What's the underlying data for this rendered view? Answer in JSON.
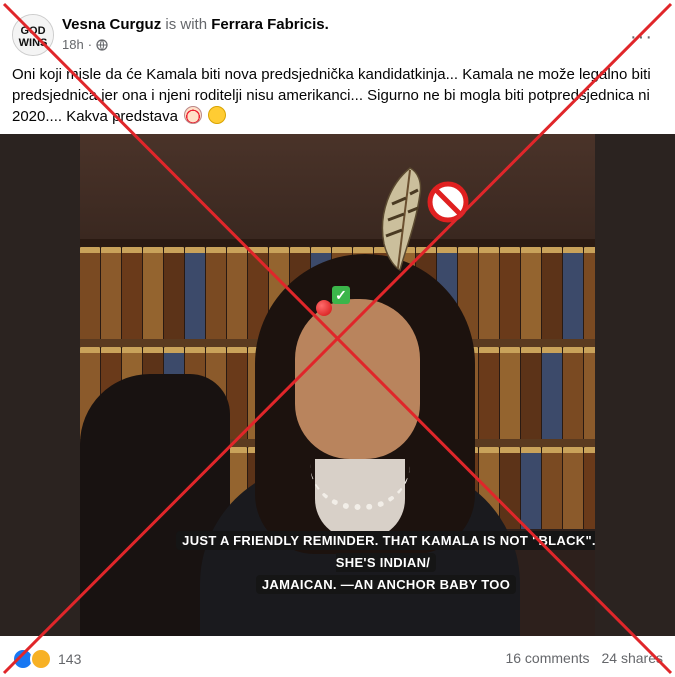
{
  "post": {
    "author": "Vesna Curguz",
    "with_label": "is with",
    "tagged": "Ferrara Fabricis.",
    "time": "18h",
    "separator": "·",
    "more_label": "···",
    "avatar_text": "GOD WINS",
    "body": "Oni koji misle da će Kamala biti nova predsjednička kandidatkinja... Kamala ne može legalno biti predsjednica jer ona i njeni roditelji nisu amerikanci... Sigurno ne bi mogla biti potpredsjednica ni 2020.... Kakva predstava"
  },
  "media": {
    "caption_line1": "JUST A FRIENDLY REMINDER. THAT KAMALA IS NOT \"BLACK\". SHE'S INDIAN/",
    "caption_line2": "JAMAICAN. —AN ANCHOR BABY TOO",
    "check_symbol": "✓"
  },
  "footer": {
    "reaction_count": "143",
    "comments": "16 comments",
    "shares": "24 shares"
  },
  "colors": {
    "cross": "#e0262a",
    "accent": "#1877f2",
    "muted_text": "#65676b"
  },
  "icons": [
    "globe-icon",
    "more-options-icon",
    "love-reaction-icon",
    "haha-reaction-icon",
    "prohibited-icon",
    "check-mark-icon",
    "feather-icon"
  ]
}
